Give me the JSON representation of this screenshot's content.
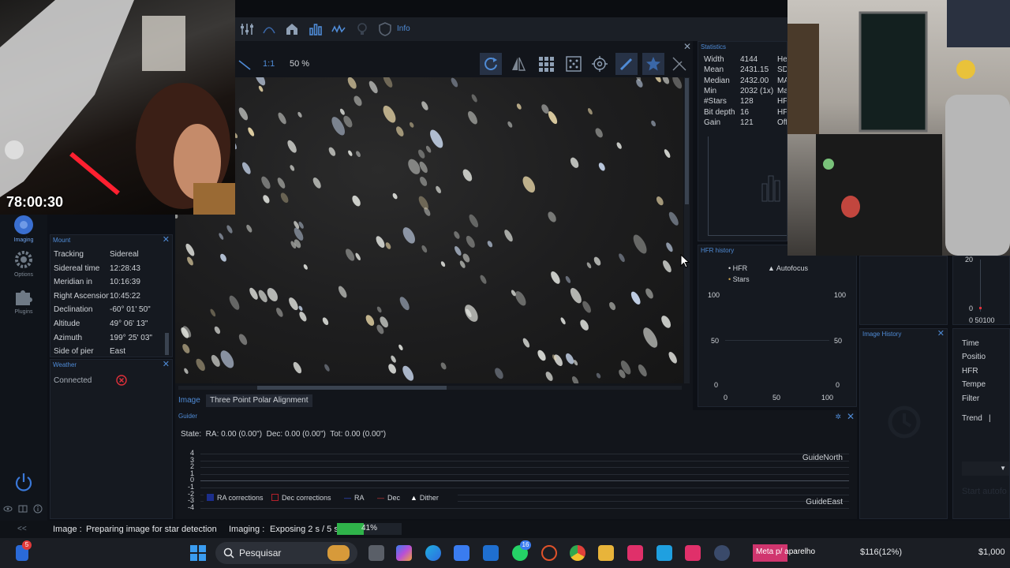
{
  "overlay": {
    "timer": "78:00:30"
  },
  "toolbar": {
    "info_label": "Info"
  },
  "image_bar": {
    "ratio_label": "1:1",
    "zoom": "50 %"
  },
  "image_tabs": [
    {
      "label": "Image"
    },
    {
      "label": "Three Point Polar Alignment"
    }
  ],
  "sidebar": {
    "items": [
      {
        "label": "Imaging"
      },
      {
        "label": "Options"
      },
      {
        "label": "Plugins"
      }
    ]
  },
  "mount": {
    "title": "Mount",
    "rows": [
      {
        "label": "Tracking",
        "value": "Sidereal"
      },
      {
        "label": "Sidereal time",
        "value": "12:28:43"
      },
      {
        "label": "Meridian in",
        "value": "10:16:39"
      },
      {
        "label": "Right Ascension",
        "value": "10:45:22"
      },
      {
        "label": "Declination",
        "value": "-60° 01' 50\""
      },
      {
        "label": "Altitude",
        "value": "49° 06' 13\""
      },
      {
        "label": "Azimuth",
        "value": "199° 25' 03\""
      },
      {
        "label": "Side of pier",
        "value": "East"
      }
    ]
  },
  "weather": {
    "title": "Weather",
    "connected_label": "Connected"
  },
  "statistics": {
    "title": "Statistics",
    "rows": [
      {
        "label": "Width",
        "value": "4144",
        "extra": "Hei"
      },
      {
        "label": "Mean",
        "value": "2431.15",
        "extra": "SD"
      },
      {
        "label": "Median",
        "value": "2432.00",
        "extra": "MA"
      },
      {
        "label": "Min",
        "value": "2032 (1x)",
        "extra": "Ma"
      },
      {
        "label": "#Stars",
        "value": "128",
        "extra": "HF"
      },
      {
        "label": "Bit depth",
        "value": "16",
        "extra": "HF"
      },
      {
        "label": "Gain",
        "value": "121",
        "extra": "Off"
      }
    ]
  },
  "hfr_history": {
    "title": "HFR history",
    "legend": {
      "hfr": "HFR",
      "autofocus": "Autofocus",
      "stars": "Stars"
    },
    "y_left": [
      "100",
      "50",
      "0"
    ],
    "y_right": [
      "100",
      "50",
      "0"
    ],
    "x_ticks": [
      "0",
      "50",
      "100"
    ]
  },
  "right_chart": {
    "y_top": "20",
    "y_bottom": "0",
    "x_label": "0 50100"
  },
  "image_history": {
    "title": "Image History"
  },
  "image_info": {
    "rows": [
      "Time",
      "Positio",
      "HFR",
      "Tempe",
      "Filter",
      "Trend"
    ],
    "trend_value": "|",
    "faded_text": "Start autofo"
  },
  "guider": {
    "title": "Guider",
    "state": "State:  RA: 0.00 (0.00\")  Dec: 0.00 (0.00\")  Tot: 0.00 (0.00\")",
    "y_labels": [
      "4",
      "3",
      "2",
      "1",
      "0",
      "-1",
      "-2",
      "-3",
      "-4"
    ],
    "north_label": "GuideNorth",
    "east_label": "GuideEast",
    "legend": [
      {
        "label": "RA corrections",
        "color": "#1c2e8c"
      },
      {
        "label": "Dec corrections",
        "color": "#b3212b"
      },
      {
        "label": "RA",
        "color": "#3752e0"
      },
      {
        "label": "Dec",
        "color": "#d23a3a"
      },
      {
        "label": "Dither",
        "color": "#ffffff"
      }
    ]
  },
  "statusbar": {
    "collapse": "<<",
    "image_label": "Image :",
    "image_status": "Preparing image for star detection",
    "imaging_label": "Imaging :",
    "imaging_status": "Exposing 2 s / 5 s",
    "progress_text": "41%",
    "progress": 0.41
  },
  "taskbar": {
    "notification_badge": "5",
    "search_placeholder": "Pesquisar",
    "whatsapp_badge": "16",
    "meta_label": "Meta p/ aparelho",
    "goal_current": "$116(12%)",
    "goal_target": "$1,000"
  },
  "colors": {
    "accent": "#4f8bd6",
    "progress": "#2fb34a",
    "close_red": "#e0303a"
  }
}
